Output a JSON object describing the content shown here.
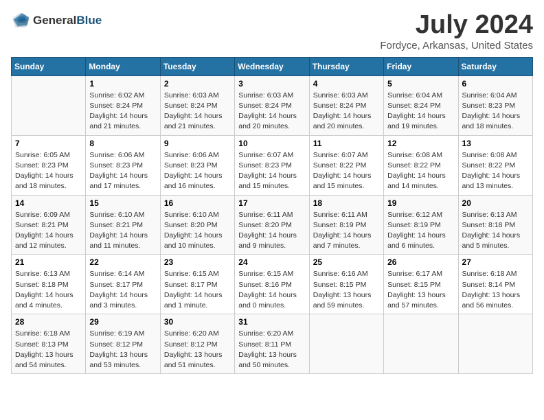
{
  "logo": {
    "general": "General",
    "blue": "Blue"
  },
  "title": "July 2024",
  "subtitle": "Fordyce, Arkansas, United States",
  "header": {
    "days": [
      "Sunday",
      "Monday",
      "Tuesday",
      "Wednesday",
      "Thursday",
      "Friday",
      "Saturday"
    ]
  },
  "weeks": [
    [
      {
        "day": "",
        "info": ""
      },
      {
        "day": "1",
        "info": "Sunrise: 6:02 AM\nSunset: 8:24 PM\nDaylight: 14 hours\nand 21 minutes."
      },
      {
        "day": "2",
        "info": "Sunrise: 6:03 AM\nSunset: 8:24 PM\nDaylight: 14 hours\nand 21 minutes."
      },
      {
        "day": "3",
        "info": "Sunrise: 6:03 AM\nSunset: 8:24 PM\nDaylight: 14 hours\nand 20 minutes."
      },
      {
        "day": "4",
        "info": "Sunrise: 6:03 AM\nSunset: 8:24 PM\nDaylight: 14 hours\nand 20 minutes."
      },
      {
        "day": "5",
        "info": "Sunrise: 6:04 AM\nSunset: 8:24 PM\nDaylight: 14 hours\nand 19 minutes."
      },
      {
        "day": "6",
        "info": "Sunrise: 6:04 AM\nSunset: 8:23 PM\nDaylight: 14 hours\nand 18 minutes."
      }
    ],
    [
      {
        "day": "7",
        "info": "Sunrise: 6:05 AM\nSunset: 8:23 PM\nDaylight: 14 hours\nand 18 minutes."
      },
      {
        "day": "8",
        "info": "Sunrise: 6:06 AM\nSunset: 8:23 PM\nDaylight: 14 hours\nand 17 minutes."
      },
      {
        "day": "9",
        "info": "Sunrise: 6:06 AM\nSunset: 8:23 PM\nDaylight: 14 hours\nand 16 minutes."
      },
      {
        "day": "10",
        "info": "Sunrise: 6:07 AM\nSunset: 8:23 PM\nDaylight: 14 hours\nand 15 minutes."
      },
      {
        "day": "11",
        "info": "Sunrise: 6:07 AM\nSunset: 8:22 PM\nDaylight: 14 hours\nand 15 minutes."
      },
      {
        "day": "12",
        "info": "Sunrise: 6:08 AM\nSunset: 8:22 PM\nDaylight: 14 hours\nand 14 minutes."
      },
      {
        "day": "13",
        "info": "Sunrise: 6:08 AM\nSunset: 8:22 PM\nDaylight: 14 hours\nand 13 minutes."
      }
    ],
    [
      {
        "day": "14",
        "info": "Sunrise: 6:09 AM\nSunset: 8:21 PM\nDaylight: 14 hours\nand 12 minutes."
      },
      {
        "day": "15",
        "info": "Sunrise: 6:10 AM\nSunset: 8:21 PM\nDaylight: 14 hours\nand 11 minutes."
      },
      {
        "day": "16",
        "info": "Sunrise: 6:10 AM\nSunset: 8:20 PM\nDaylight: 14 hours\nand 10 minutes."
      },
      {
        "day": "17",
        "info": "Sunrise: 6:11 AM\nSunset: 8:20 PM\nDaylight: 14 hours\nand 9 minutes."
      },
      {
        "day": "18",
        "info": "Sunrise: 6:11 AM\nSunset: 8:19 PM\nDaylight: 14 hours\nand 7 minutes."
      },
      {
        "day": "19",
        "info": "Sunrise: 6:12 AM\nSunset: 8:19 PM\nDaylight: 14 hours\nand 6 minutes."
      },
      {
        "day": "20",
        "info": "Sunrise: 6:13 AM\nSunset: 8:18 PM\nDaylight: 14 hours\nand 5 minutes."
      }
    ],
    [
      {
        "day": "21",
        "info": "Sunrise: 6:13 AM\nSunset: 8:18 PM\nDaylight: 14 hours\nand 4 minutes."
      },
      {
        "day": "22",
        "info": "Sunrise: 6:14 AM\nSunset: 8:17 PM\nDaylight: 14 hours\nand 3 minutes."
      },
      {
        "day": "23",
        "info": "Sunrise: 6:15 AM\nSunset: 8:17 PM\nDaylight: 14 hours\nand 1 minute."
      },
      {
        "day": "24",
        "info": "Sunrise: 6:15 AM\nSunset: 8:16 PM\nDaylight: 14 hours\nand 0 minutes."
      },
      {
        "day": "25",
        "info": "Sunrise: 6:16 AM\nSunset: 8:15 PM\nDaylight: 13 hours\nand 59 minutes."
      },
      {
        "day": "26",
        "info": "Sunrise: 6:17 AM\nSunset: 8:15 PM\nDaylight: 13 hours\nand 57 minutes."
      },
      {
        "day": "27",
        "info": "Sunrise: 6:18 AM\nSunset: 8:14 PM\nDaylight: 13 hours\nand 56 minutes."
      }
    ],
    [
      {
        "day": "28",
        "info": "Sunrise: 6:18 AM\nSunset: 8:13 PM\nDaylight: 13 hours\nand 54 minutes."
      },
      {
        "day": "29",
        "info": "Sunrise: 6:19 AM\nSunset: 8:12 PM\nDaylight: 13 hours\nand 53 minutes."
      },
      {
        "day": "30",
        "info": "Sunrise: 6:20 AM\nSunset: 8:12 PM\nDaylight: 13 hours\nand 51 minutes."
      },
      {
        "day": "31",
        "info": "Sunrise: 6:20 AM\nSunset: 8:11 PM\nDaylight: 13 hours\nand 50 minutes."
      },
      {
        "day": "",
        "info": ""
      },
      {
        "day": "",
        "info": ""
      },
      {
        "day": "",
        "info": ""
      }
    ]
  ]
}
